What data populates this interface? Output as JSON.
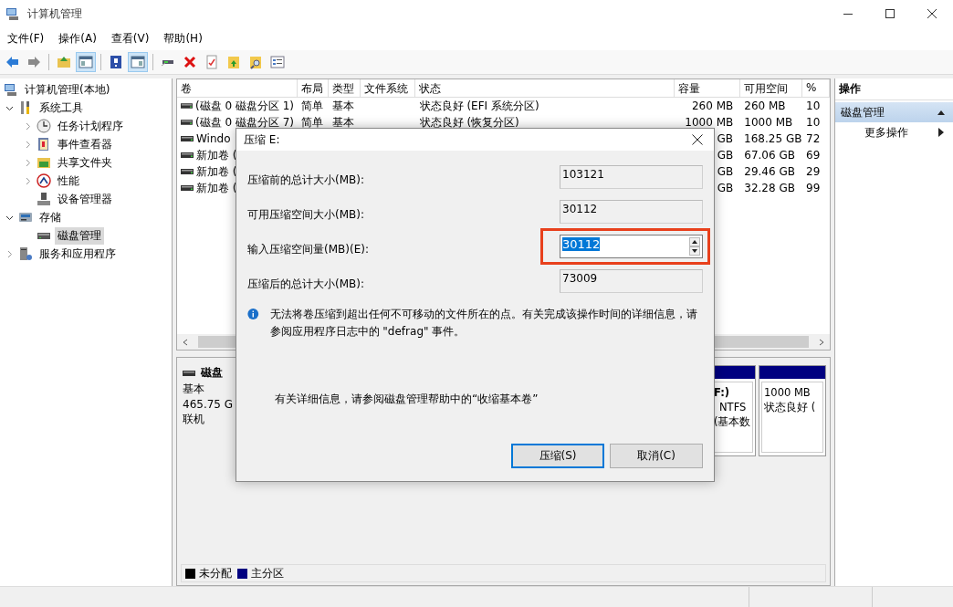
{
  "window": {
    "title": "计算机管理"
  },
  "menu": [
    "文件(F)",
    "操作(A)",
    "查看(V)",
    "帮助(H)"
  ],
  "toolbar": [
    {
      "on": false
    },
    {
      "on": false
    },
    {
      "on": false
    },
    {
      "on": true
    },
    {
      "on": false
    },
    {
      "on": true
    },
    {
      "on": false
    },
    {
      "on": false
    },
    {
      "on": false
    },
    {
      "on": false
    },
    {
      "on": false
    },
    {
      "on": false
    }
  ],
  "tree": [
    {
      "label": "计算机管理(本地)",
      "selected": false,
      "children": [
        {
          "label": "系统工具",
          "selected": false,
          "expanded": true,
          "children": [
            {
              "label": "任务计划程序",
              "selected": false,
              "expanded": false
            },
            {
              "label": "事件查看器",
              "selected": false,
              "expanded": false
            },
            {
              "label": "共享文件夹",
              "selected": false,
              "expanded": false
            },
            {
              "label": "性能",
              "selected": false,
              "expanded": false
            },
            {
              "label": "设备管理器",
              "selected": false
            }
          ]
        },
        {
          "label": "存储",
          "selected": false,
          "expanded": true,
          "children": [
            {
              "label": "磁盘管理",
              "selected": true
            }
          ]
        },
        {
          "label": "服务和应用程序",
          "selected": false,
          "expanded": false
        }
      ]
    }
  ],
  "table": {
    "columns": [
      "卷",
      "布局",
      "类型",
      "文件系统",
      "状态",
      "容量",
      "可用空间",
      "%"
    ],
    "rows": [
      {
        "volume": "(磁盘 0 磁盘分区 1)",
        "layout": "简单",
        "type": "基本",
        "status": "状态良好 (EFI 系统分区)",
        "capacity": "260 MB",
        "free": "260 MB",
        "percent": "10"
      },
      {
        "volume": "(磁盘 0 磁盘分区 7)",
        "layout": "简单",
        "type": "基本",
        "status": "状态良好 (恢复分区)",
        "capacity": "1000 MB",
        "free": "1000 MB",
        "percent": "10"
      },
      {
        "volume": "Windo",
        "capacity": "GB",
        "free": "168.25 GB",
        "percent": "72"
      },
      {
        "volume": "新加卷 (",
        "capacity": "GB",
        "free": "67.06 GB",
        "percent": "69"
      },
      {
        "volume": "新加卷 (",
        "capacity": "GB",
        "free": "29.46 GB",
        "percent": "29"
      },
      {
        "volume": "新加卷 (",
        "capacity": "GB",
        "free": "32.28 GB",
        "percent": "99"
      }
    ]
  },
  "disk": {
    "name": "磁盘",
    "type": "基本",
    "size": "465.75 G",
    "state": "联机",
    "partitions": [
      {
        "label": "F:)",
        "fs": "NTFS",
        "status": "(基本数"
      },
      {
        "size": "1000 MB",
        "status": "状态良好 ("
      }
    ]
  },
  "legend": [
    {
      "label": "未分配",
      "color": "#000000"
    },
    {
      "label": "主分区",
      "color": "#000080"
    }
  ],
  "actions": {
    "header": "操作",
    "items": [
      {
        "label": "磁盘管理",
        "kind": "section",
        "expanded": true
      },
      {
        "label": "更多操作",
        "kind": "action"
      }
    ]
  },
  "dialog": {
    "title": "压缩 E:",
    "fields": [
      {
        "label": "压缩前的总计大小(MB):",
        "value": "103121",
        "kind": "readonly"
      },
      {
        "label": "可用压缩空间大小(MB):",
        "value": "30112",
        "kind": "readonly"
      },
      {
        "label": "输入压缩空间量(MB)(E):",
        "value": "30112",
        "kind": "spinner",
        "highlighted": true
      },
      {
        "label": "压缩后的总计大小(MB):",
        "value": "73009",
        "kind": "readonly"
      }
    ],
    "info": "无法将卷压缩到超出任何不可移动的文件所在的点。有关完成该操作时间的详细信息，请参阅应用程序日志中的 \"defrag\" 事件。",
    "help": "有关详细信息，请参阅磁盘管理帮助中的“收缩基本卷”",
    "buttons": [
      {
        "label": "压缩(S)",
        "default": true
      },
      {
        "label": "取消(C)",
        "default": false
      }
    ]
  }
}
